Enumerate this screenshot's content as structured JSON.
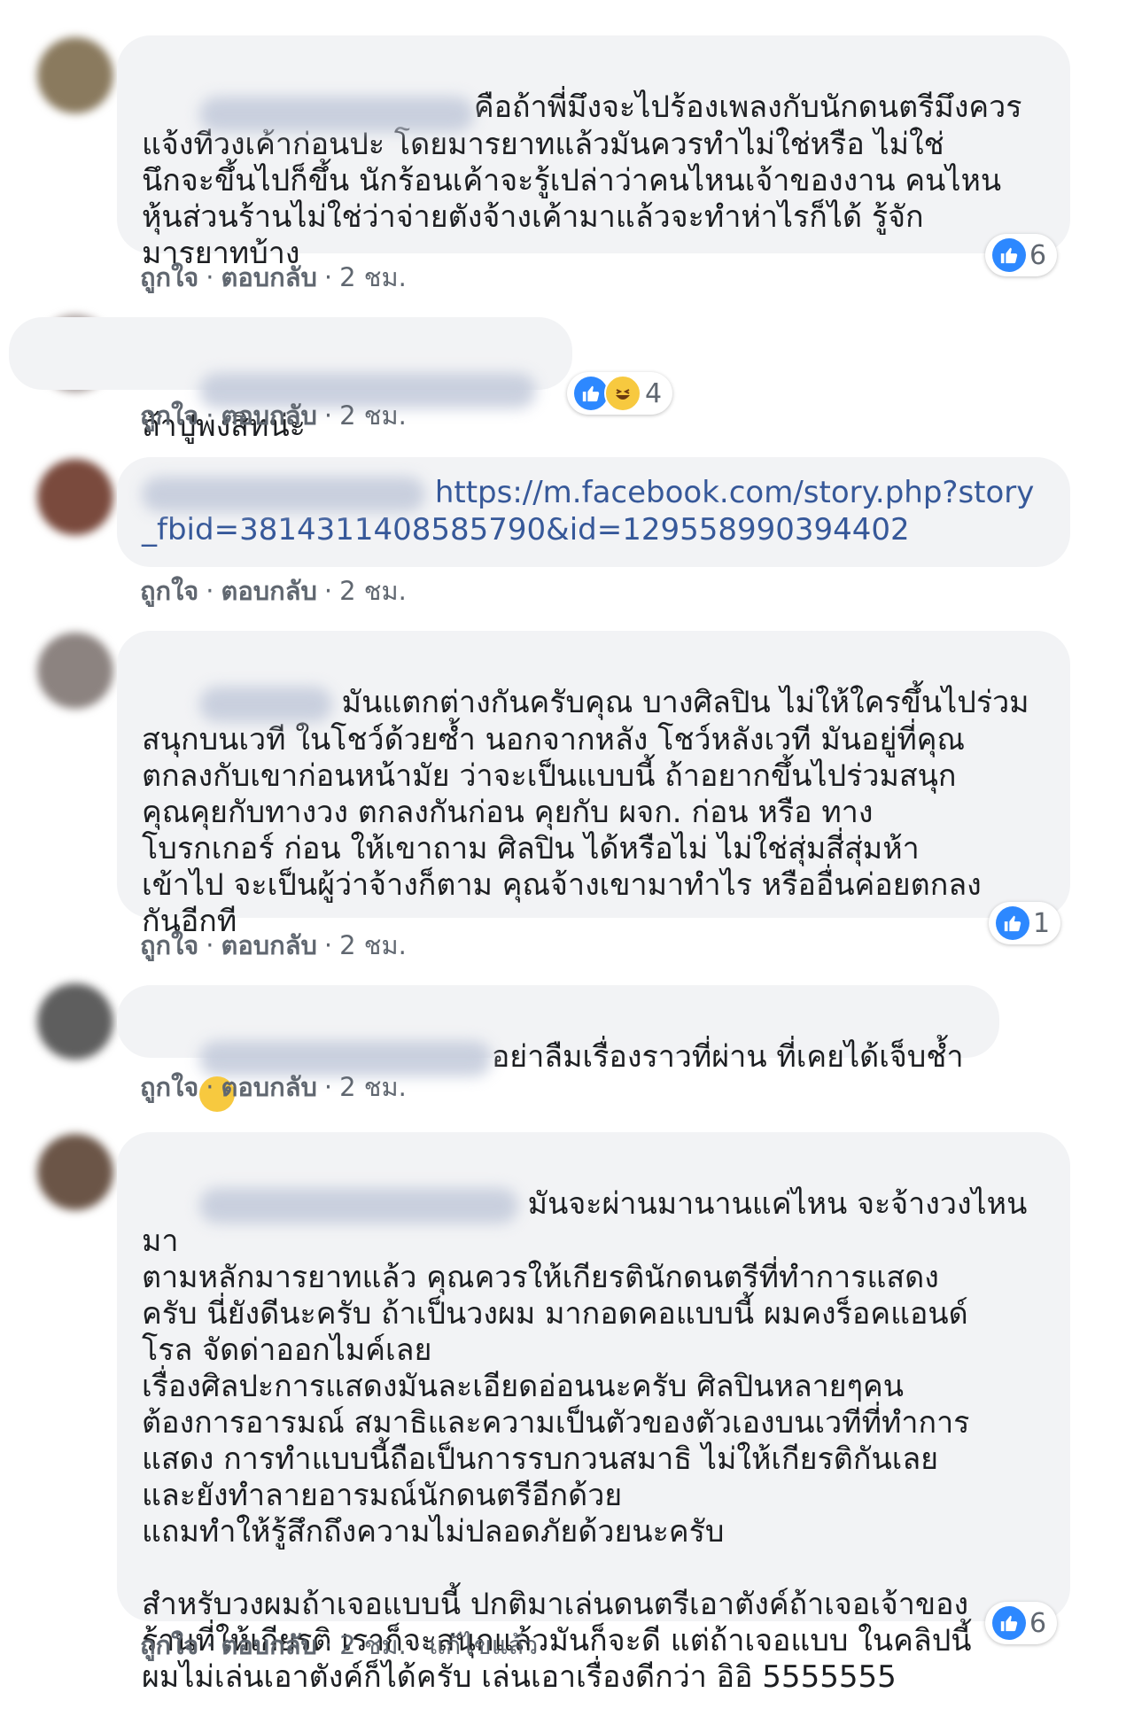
{
  "colors": {
    "like_blue": "#2d88ff",
    "link": "#365899",
    "bubble_bg": "#f2f3f5",
    "meta_gray": "#606770"
  },
  "labels": {
    "like": "ถูกใจ",
    "reply": "ตอบกลับ",
    "dot": "·"
  },
  "comments": [
    {
      "author": "",
      "text": "คือถ้าพี่มึงจะไปร้องเพลงกับนักดนตรีมึงควร\nแจ้งทีวงเค้าก่อนปะ โดยมารยาทแล้วมันควรทำไม่ใช่หรือ ไม่ใช่\nนึกจะขึ้นไปก็ขึ้น นักร้อนเค้าจะรู้เปล่าว่าคนไหนเจ้าของงาน คนไหน\nหุ้นส่วนร้านไม่ใช่ว่าจ่ายตังจ้างเค้ามาแล้วจะทำห่าไรก็ได้ รู้จัก\nมารยาทบ้าง",
      "time": "2 ชม.",
      "reaction_count": "6",
      "reaction_icons": [
        "like-icon"
      ]
    },
    {
      "author": "",
      "text": "ถ้าปูพงสิทน่ะ",
      "time": "2 ชม.",
      "reaction_count": "4",
      "reaction_icons": [
        "like-icon",
        "haha-icon"
      ]
    },
    {
      "author": "",
      "link": "https://m.facebook.com/story.php?story_fbid=3814311408585790&id=129558990394402",
      "time": "2 ชม."
    },
    {
      "author": "",
      "text": "มันแตกต่างกันครับคุณ บางศิลปิน ไม่ให้ใครขึ้นไปร่วม\nสนุกบนเวที ในโชว์ด้วยซ้ำ นอกจากหลัง โชว์หลังเวที มันอยู่ที่คุณ\nตกลงกับเขาก่อนหน้ามัย ว่าจะเป็นแบบนี้ ถ้าอยากขึ้นไปร่วมสนุก\nคุณคุยกับทางวง ตกลงกันก่อน คุยกับ ผจก. ก่อน หรือ ทาง\nโบรกเกอร์ ก่อน ให้เขาถาม ศิลปิน ได้หรือไม่ ไม่ใช่สุ่มสี่สุ่มห้า\nเข้าไป จะเป็นผู้ว่าจ้างก็ตาม คุณจ้างเขามาทำไร หรืออื่นค่อยตกลง\nกันอีกที",
      "time": "2 ชม.",
      "reaction_count": "1",
      "reaction_icons": [
        "like-icon"
      ]
    },
    {
      "author": "",
      "text": "อย่าลืมเรื่องราวที่ผ่าน ที่เคยได้เจ็บช้ำ",
      "time": "2 ชม.",
      "emoji": "laughing-crying-emoji"
    },
    {
      "author": "",
      "text": "มันจะผ่านมานานแค่ไหน จะจ้างวงไหนมา\nตามหลักมารยาทแล้ว คุณควรให้เกียรตินักดนตรีที่ทำการแสดง\nครับ นี่ยังดีนะครับ ถ้าเป็นวงผม มากอดคอแบบนี้ ผมคงร็อคแอนด์\nโรล จัดด่าออกไมค์เลย\nเรื่องศิลปะการแสดงมันละเอียดอ่อนนะครับ ศิลปินหลายๆคน\nต้องการอารมณ์ สมาธิและความเป็นตัวของตัวเองบนเวทีที่ทำการ\nแสดง การทำแบบนี้ถือเป็นการรบกวนสมาธิ ไม่ให้เกียรติกันเลย\nและยังทำลายอารมณ์นักดนตรีอีกด้วย\nแถมทำให้รู้สึกถึงความไม่ปลอดภัยด้วยนะครับ\n\nสำหรับวงผมถ้าเจอแบบนี้ ปกติมาเล่นดนตรีเอาตังค์ถ้าเจอเจ้าของ\nร้านที่ให้เกียรติ เราก็จะสนุกแล้วมันก็จะดี แต่ถ้าเจอแบบ ในคลิปนี้\nผมไม่เล่นเอาตังค์ก็ได้ครับ เล่นเอาเรื่องดีกว่า อิอิ 5555555",
      "time": "2 ชม.",
      "edited": "แก้ไขแล้ว",
      "reaction_count": "6",
      "reaction_icons": [
        "like-icon"
      ]
    }
  ]
}
